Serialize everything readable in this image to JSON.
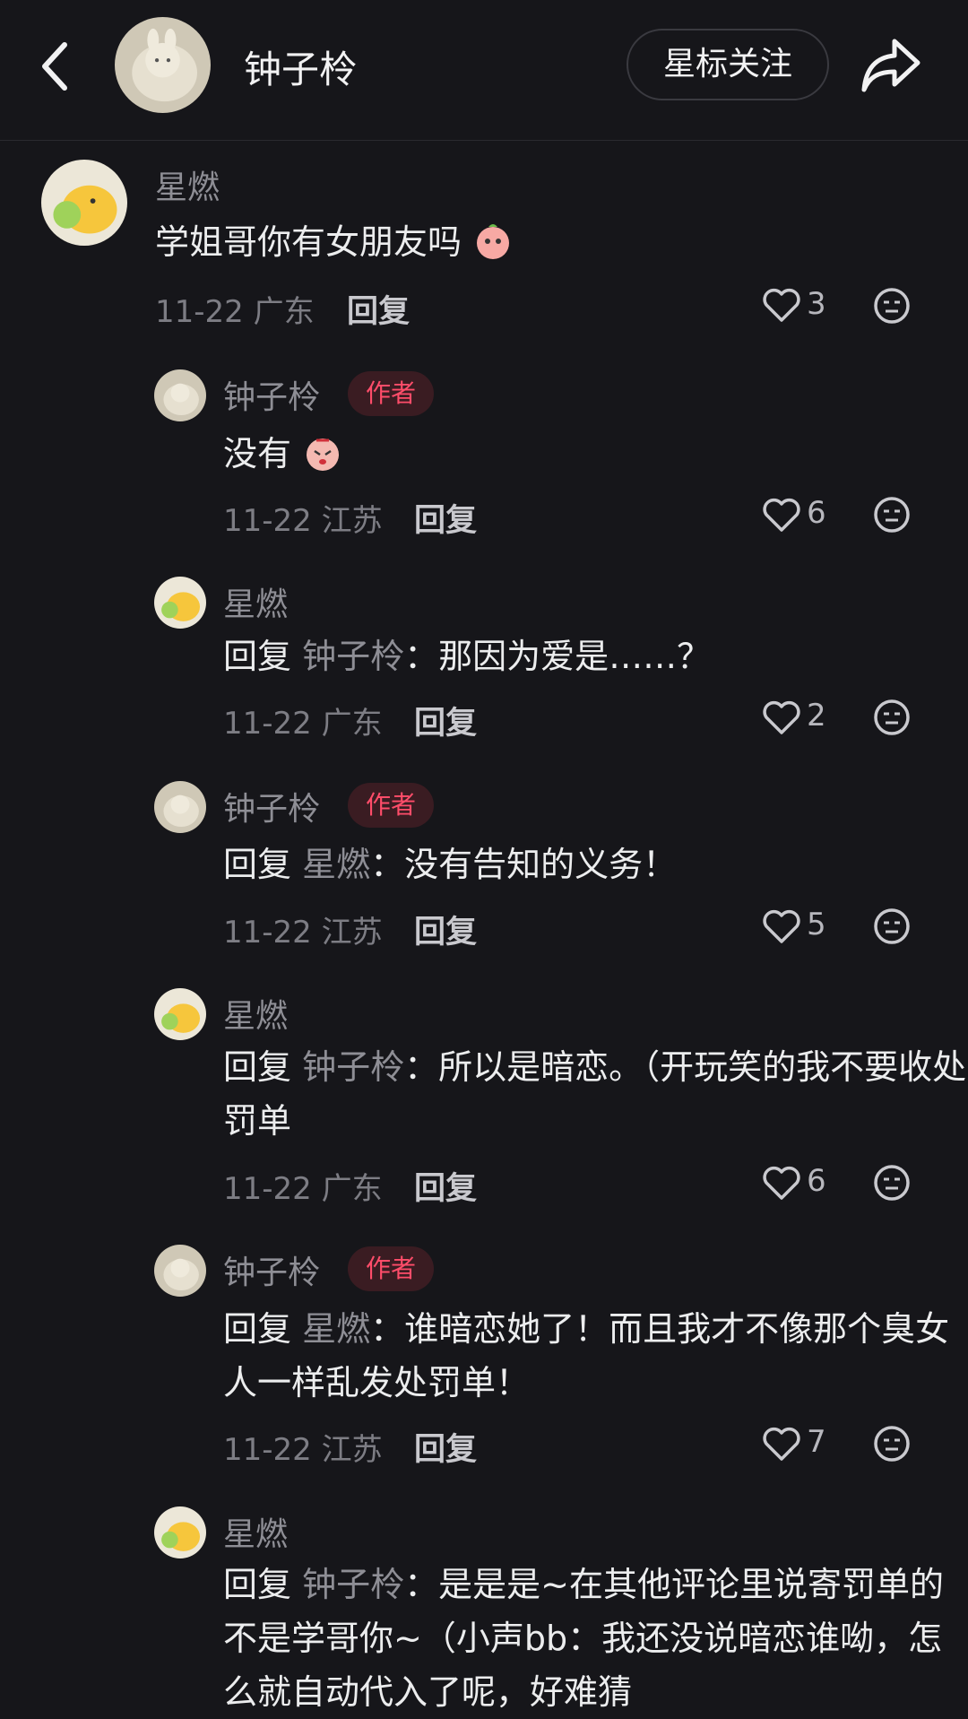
{
  "header": {
    "title": "钟子柃",
    "star_follow": "星标关注"
  },
  "comments": [
    {
      "name": "星燃",
      "is_author": false,
      "reply_prefix": "",
      "reply_target": "",
      "text": "学姐哥你有女朋友吗",
      "date": "11-22",
      "location": "广东",
      "reply_label": "回复",
      "likes": "3"
    },
    {
      "name": "钟子柃",
      "is_author": true,
      "author_tag": "作者",
      "reply_prefix": "",
      "reply_target": "",
      "text": "没有",
      "date": "11-22",
      "location": "江苏",
      "reply_label": "回复",
      "likes": "6"
    },
    {
      "name": "星燃",
      "is_author": false,
      "reply_prefix": "回复",
      "reply_target": "钟子柃",
      "text": "：那因为爱是……？",
      "date": "11-22",
      "location": "广东",
      "reply_label": "回复",
      "likes": "2"
    },
    {
      "name": "钟子柃",
      "is_author": true,
      "author_tag": "作者",
      "reply_prefix": "回复",
      "reply_target": "星燃",
      "text": "：没有告知的义务！",
      "date": "11-22",
      "location": "江苏",
      "reply_label": "回复",
      "likes": "5"
    },
    {
      "name": "星燃",
      "is_author": false,
      "reply_prefix": "回复",
      "reply_target": "钟子柃",
      "text": "：所以是暗恋。（开玩笑的我不要收处罚单",
      "date": "11-22",
      "location": "广东",
      "reply_label": "回复",
      "likes": "6"
    },
    {
      "name": "钟子柃",
      "is_author": true,
      "author_tag": "作者",
      "reply_prefix": "回复",
      "reply_target": "星燃",
      "text": "：谁暗恋她了！而且我才不像那个臭女人一样乱发处罚单！",
      "date": "11-22",
      "location": "江苏",
      "reply_label": "回复",
      "likes": "7"
    },
    {
      "name": "星燃",
      "is_author": false,
      "reply_prefix": "回复",
      "reply_target": "钟子柃",
      "text": "：是是是~在其他评论里说寄罚单的不是学哥你~（小声bb：我还没说暗恋谁呦，怎么就自动代入了呢，好难猜",
      "date": "",
      "location": "",
      "reply_label": "",
      "likes": ""
    }
  ]
}
